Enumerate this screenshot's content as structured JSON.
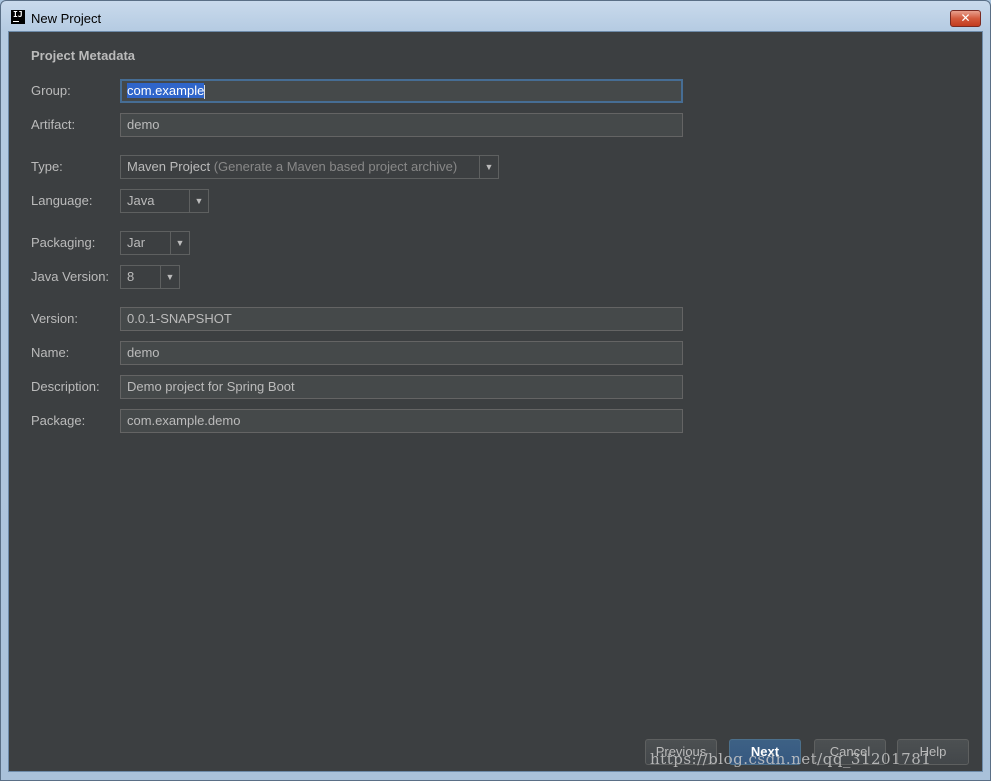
{
  "window": {
    "title": "New Project",
    "app_icon_text": "IJ",
    "close_glyph": "✕"
  },
  "form": {
    "section_title": "Project Metadata",
    "group": {
      "label": "Group:",
      "value": "com.example"
    },
    "artifact": {
      "label": "Artifact:",
      "value": "demo"
    },
    "type": {
      "label": "Type:",
      "value": "Maven Project",
      "hint": "(Generate a Maven based project archive)"
    },
    "language": {
      "label": "Language:",
      "value": "Java"
    },
    "packaging": {
      "label": "Packaging:",
      "value": "Jar"
    },
    "java_version": {
      "label": "Java Version:",
      "value": "8"
    },
    "version": {
      "label": "Version:",
      "value": "0.0.1-SNAPSHOT"
    },
    "name": {
      "label": "Name:",
      "value": "demo"
    },
    "description": {
      "label": "Description:",
      "value": "Demo project for Spring Boot"
    },
    "package": {
      "label": "Package:",
      "value": "com.example.demo"
    }
  },
  "footer": {
    "previous_label": "Previous",
    "next_label": "Next",
    "cancel_label": "Cancel",
    "help_label": "Help"
  },
  "watermark": "https://blog.csdn.net/qq_31201781",
  "icons": {
    "dropdown": "chevron-down-icon",
    "close": "close-icon",
    "app": "intellij-icon"
  },
  "colors": {
    "background": "#3c3f41",
    "field": "#45494a",
    "text": "#bbbbbb",
    "primary_button": "#365880",
    "selection": "#2f65ca"
  }
}
